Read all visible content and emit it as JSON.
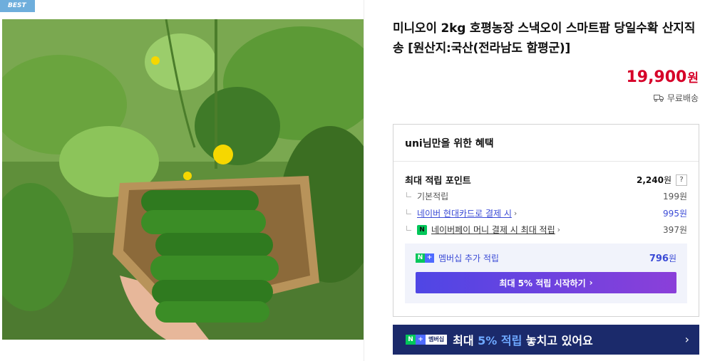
{
  "badge": "BEST",
  "product": {
    "title": "미니오이 2kg 호평농장 스낵오이 스마트팜 당일수확 산지직송 [원산지:국산(전라남도 함평군)]",
    "price": "19,900",
    "price_unit": "원",
    "shipping": "무료배송"
  },
  "benefit": {
    "heading": "uni님만을 위한 혜택",
    "max_label": "최대 적립 포인트",
    "max_value": "2,240",
    "max_unit": "원",
    "help": "?",
    "rows": [
      {
        "label": "기본적립",
        "value": "199원"
      },
      {
        "label": "네이버 현대카드로 결제 시",
        "value": "995원"
      },
      {
        "label": "네이버페이 머니 결제 시 최대 적립",
        "value": "397원"
      }
    ],
    "npay_icon": "N",
    "membership_label": "멤버십 추가 적립",
    "membership_value": "796",
    "membership_unit": "원",
    "nplus_n": "N",
    "nplus_p": "+",
    "start_button": "최대 5% 적립 시작하기"
  },
  "banner": {
    "tag_n": "N",
    "tag_p": "+",
    "tag_label": "멤버십",
    "text_pre": "최대 ",
    "text_hl": "5% 적립",
    "text_post": " 놓치고 있어요"
  },
  "colors": {
    "price": "#d60028",
    "accent_blue": "#3b4bd6",
    "naver_green": "#03c75a",
    "banner_bg": "#1b2a6b"
  }
}
